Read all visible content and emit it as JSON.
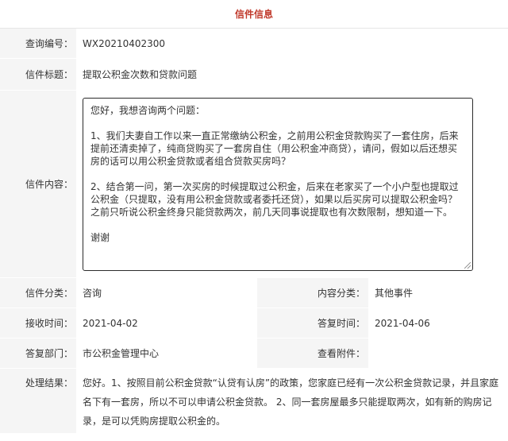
{
  "header": {
    "title": "信件信息"
  },
  "fields": {
    "query_id": {
      "label": "查询编号：",
      "value": "WX20210402300"
    },
    "subject": {
      "label": "信件标题：",
      "value": "提取公积金次数和贷款问题"
    },
    "content": {
      "label": "信件内容：",
      "paragraphs": [
        "您好，我想咨询两个问题：",
        "1、我们夫妻自工作以来一直正常缴纳公积金，之前用公积金贷款购买了一套住房，后来提前还清卖掉了，纯商贷购买了一套房自住（用公积金冲商贷），请问，假如以后还想买房的话可以用公积金贷款或者组合贷款买房吗？",
        "2、结合第一问，第一次买房的时候提取过公积金，后来在老家买了一个小户型也提取过公积金（只提取，没有用公积金贷款或者委托还贷），如果以后买房可以提取公积金吗？之前只听说公积金终身只能贷款两次，前几天同事说提取也有次数限制，想知道一下。",
        "谢谢"
      ]
    },
    "category": {
      "label": "信件分类：",
      "value": "咨询"
    },
    "content_category": {
      "label": "内容分类：",
      "value": "其他事件"
    },
    "received_time": {
      "label": "接收时间：",
      "value": "2021-04-02"
    },
    "reply_time": {
      "label": "答复时间：",
      "value": "2021-04-06"
    },
    "reply_dept": {
      "label": "答复部门：",
      "value": "市公积金管理中心"
    },
    "attachment": {
      "label": "查看附件：",
      "value": ""
    },
    "result": {
      "label": "处理结果：",
      "value": "您好。1、按照目前公积金贷款“认贷有认房”的政策，您家庭已经有一次公积金贷款记录，并且家庭名下有一套房，所以不可以申请公积金贷款。 2、同一套房屋最多只能提取两次，如有新的购房记录，是可以凭购房提取公积金的。"
    }
  }
}
